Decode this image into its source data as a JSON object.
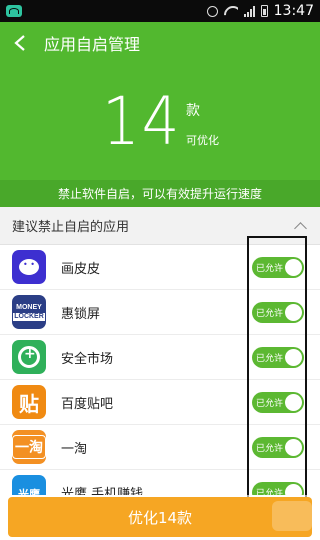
{
  "status_bar": {
    "time": "13:47",
    "icons": [
      "app-notification-icon",
      "alarm-icon",
      "wifi-icon",
      "signal-icon",
      "battery-icon"
    ]
  },
  "header": {
    "title": "应用自启管理",
    "count": "14",
    "count_unit": "款",
    "count_caption": "可优化",
    "tip": "禁止软件自启，可以有效提升运行速度",
    "background_color": "#52b82f"
  },
  "section": {
    "title": "建议禁止自启的应用"
  },
  "apps": [
    {
      "name": "画皮皮",
      "icon": "huapipi-icon",
      "toggle_label": "已允许"
    },
    {
      "name": "惠锁屏",
      "icon": "money-locker-icon",
      "icon_text": [
        "MONEY",
        "LOCKER"
      ],
      "toggle_label": "已允许"
    },
    {
      "name": "安全市场",
      "icon": "safe-market-icon",
      "toggle_label": "已允许"
    },
    {
      "name": "百度贴吧",
      "icon": "tieba-icon",
      "icon_text": "贴",
      "toggle_label": "已允许"
    },
    {
      "name": "一淘",
      "icon": "yitao-icon",
      "icon_text": "一淘",
      "toggle_label": "已允许"
    },
    {
      "name": "光鹰 手机赚钱",
      "icon": "guangying-icon",
      "icon_text": "光鹰",
      "toggle_label": "已允许"
    }
  ],
  "optimize_button": {
    "label": "优化14款",
    "color": "#f6a623"
  },
  "colors": {
    "toggle_on": "#5cb832",
    "tip_bar": "#49a82a"
  }
}
